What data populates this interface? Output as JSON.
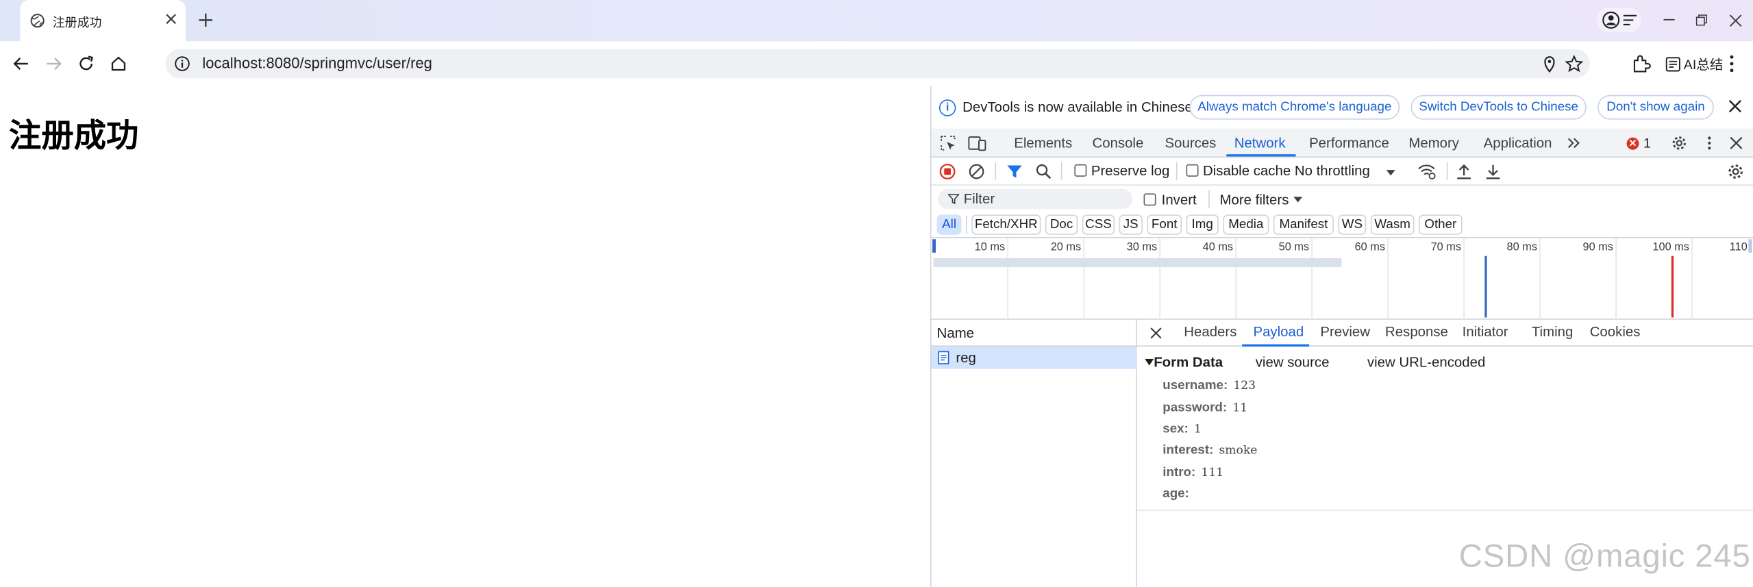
{
  "tab": {
    "title": "注册成功"
  },
  "address": {
    "url": "localhost:8080/springmvc/user/reg"
  },
  "toolbar": {
    "ai_label": "AI总结"
  },
  "page": {
    "heading": "注册成功"
  },
  "devtools": {
    "infobar": {
      "text": "DevTools is now available in Chinese!",
      "btn_match": "Always match Chrome's language",
      "btn_switch": "Switch DevTools to Chinese",
      "btn_dont": "Don't show again"
    },
    "tabs": [
      "Elements",
      "Console",
      "Sources",
      "Network",
      "Performance",
      "Memory",
      "Application"
    ],
    "active_tab": "Network",
    "error_count": "1",
    "network_toolbar": {
      "preserve_log": "Preserve log",
      "disable_cache": "Disable cache",
      "throttling": "No throttling"
    },
    "filter": {
      "placeholder": "Filter",
      "invert": "Invert",
      "more_filters": "More filters"
    },
    "type_filters": [
      "All",
      "Fetch/XHR",
      "Doc",
      "CSS",
      "JS",
      "Font",
      "Img",
      "Media",
      "Manifest",
      "WS",
      "Wasm",
      "Other"
    ],
    "timeline_ticks": [
      "10 ms",
      "20 ms",
      "30 ms",
      "40 ms",
      "50 ms",
      "60 ms",
      "70 ms",
      "80 ms",
      "90 ms",
      "100 ms",
      "110"
    ],
    "requests": {
      "header": "Name",
      "items": [
        "reg"
      ]
    },
    "detail": {
      "tabs": [
        "Headers",
        "Payload",
        "Preview",
        "Response",
        "Initiator",
        "Timing",
        "Cookies"
      ],
      "active_tab": "Payload",
      "form_data": {
        "title": "Form Data",
        "view_source": "view source",
        "view_url_encoded": "view URL-encoded",
        "fields": [
          {
            "key": "username:",
            "value": "123"
          },
          {
            "key": "password:",
            "value": "11"
          },
          {
            "key": "sex:",
            "value": "1"
          },
          {
            "key": "interest:",
            "value": "smoke"
          },
          {
            "key": "intro:",
            "value": "111"
          },
          {
            "key": "age:",
            "value": ""
          }
        ]
      }
    }
  },
  "watermark": "CSDN @magic 245",
  "colors": {
    "accent": "#1a73e8",
    "selected_row": "#d3e3fd",
    "error": "#d93025"
  }
}
